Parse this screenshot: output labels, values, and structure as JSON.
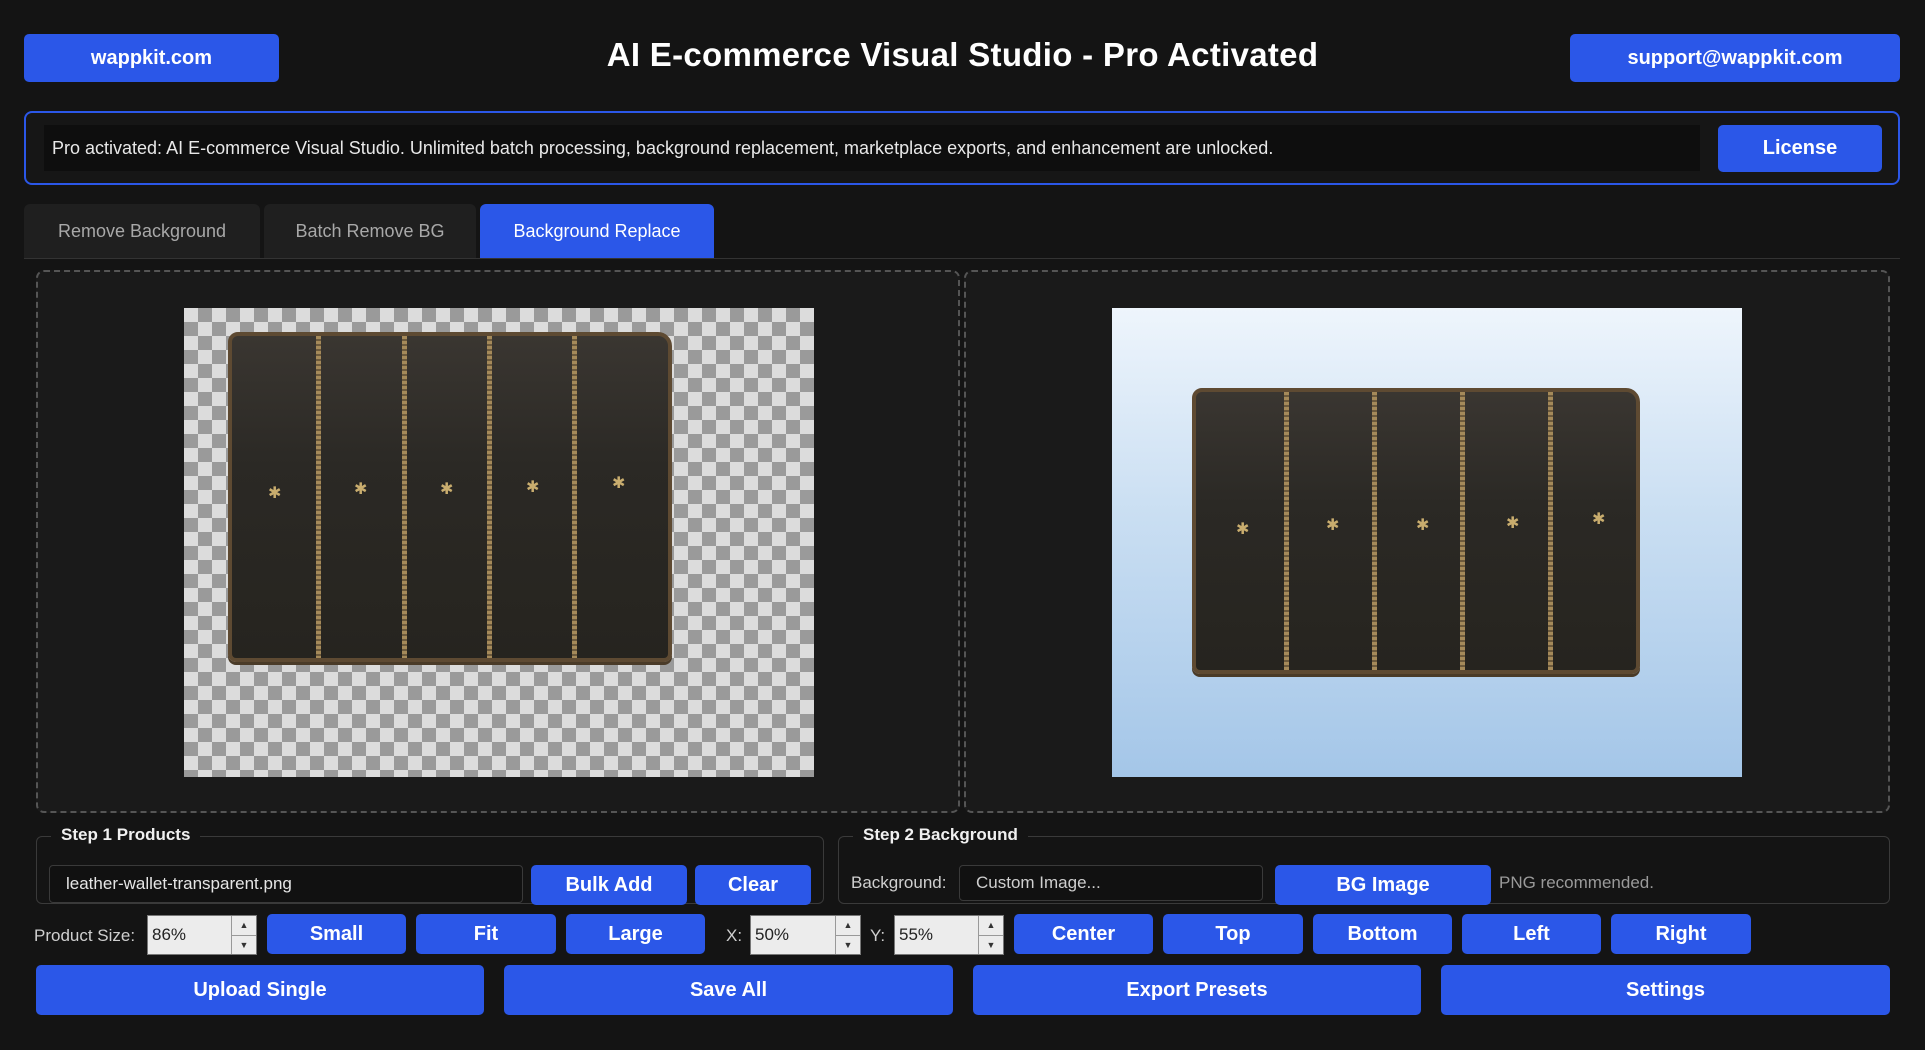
{
  "header": {
    "left_link": "wappkit.com",
    "title": "AI E-commerce Visual Studio - Pro Activated",
    "right_link": "support@wappkit.com"
  },
  "banner": {
    "message": "Pro activated: AI E-commerce Visual Studio. Unlimited batch processing, background replacement, marketplace exports, and enhancement are unlocked.",
    "license_label": "License"
  },
  "tabs": [
    {
      "label": "Remove Background",
      "active": false
    },
    {
      "label": "Batch Remove BG",
      "active": false
    },
    {
      "label": "Background Replace",
      "active": true
    }
  ],
  "previews": {
    "left": "transparent-product-preview",
    "right": "composited-background-preview"
  },
  "step1": {
    "title": "Step 1 Products",
    "file_value": "leather-wallet-transparent.png",
    "bulk_add_label": "Bulk Add",
    "clear_label": "Clear"
  },
  "step2": {
    "title": "Step 2 Background",
    "background_label": "Background:",
    "background_value": "Custom Image...",
    "bg_image_label": "BG Image",
    "note": "PNG recommended."
  },
  "controls": {
    "product_size_label": "Product Size:",
    "product_size_value": "86%",
    "small_label": "Small",
    "fit_label": "Fit",
    "large_label": "Large",
    "x_label": "X:",
    "x_value": "50%",
    "y_label": "Y:",
    "y_value": "55%",
    "center_label": "Center",
    "top_label": "Top",
    "bottom_label": "Bottom",
    "left_label": "Left",
    "right_label": "Right"
  },
  "actions": {
    "upload_single": "Upload Single",
    "save_all": "Save All",
    "export_presets": "Export Presets",
    "settings": "Settings"
  },
  "colors": {
    "accent": "#2b57e8",
    "background": "#141414",
    "panel": "#1a1a1a"
  }
}
